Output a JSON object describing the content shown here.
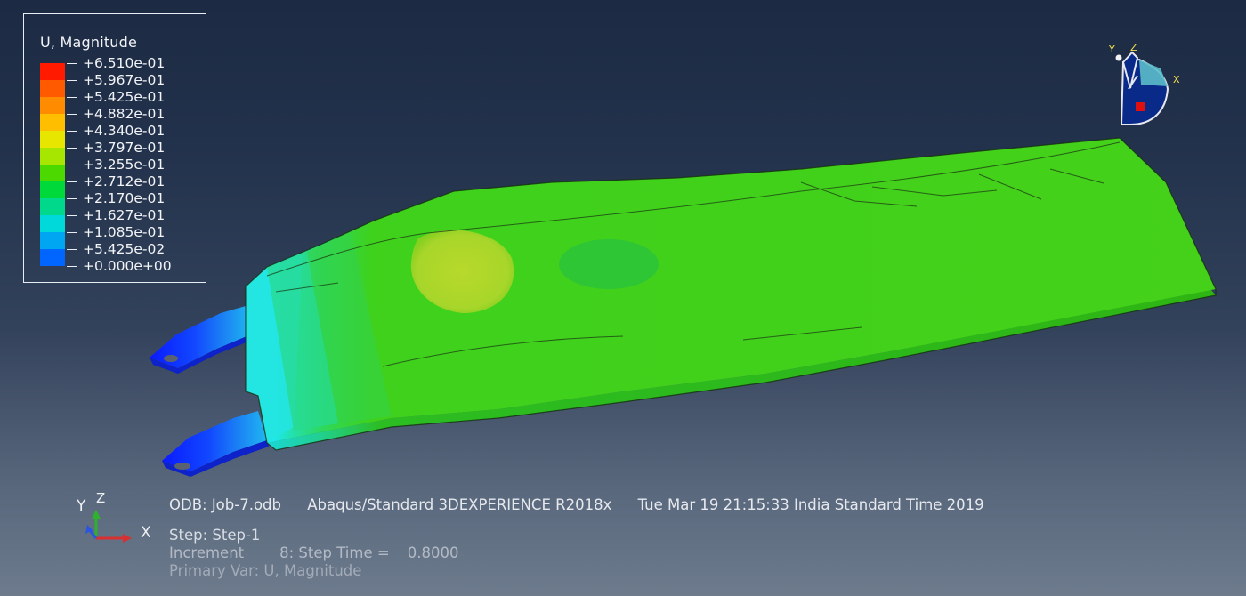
{
  "legend": {
    "title": "U, Magnitude",
    "entries": [
      {
        "label": "+6.510e-01",
        "color": "#ff1a00"
      },
      {
        "label": "+5.967e-01",
        "color": "#ff5a00"
      },
      {
        "label": "+5.425e-01",
        "color": "#ff8c00"
      },
      {
        "label": "+4.882e-01",
        "color": "#ffbf00"
      },
      {
        "label": "+4.340e-01",
        "color": "#e6e600"
      },
      {
        "label": "+3.797e-01",
        "color": "#a6e600"
      },
      {
        "label": "+3.255e-01",
        "color": "#4cd900"
      },
      {
        "label": "+2.712e-01",
        "color": "#00d93a"
      },
      {
        "label": "+2.170e-01",
        "color": "#00d98c"
      },
      {
        "label": "+1.627e-01",
        "color": "#00d9d9"
      },
      {
        "label": "+1.085e-01",
        "color": "#00a6f2"
      },
      {
        "label": "+5.425e-02",
        "color": "#0066ff"
      },
      {
        "label": "+0.000e+00",
        "color": "#0a1aff"
      }
    ]
  },
  "info": {
    "odb": "ODB: Job-7.odb",
    "solver": "Abaqus/Standard 3DEXPERIENCE R2018x",
    "timestamp": "Tue Mar 19 21:15:33 India Standard Time 2019",
    "step": "Step: Step-1",
    "increment_label": "Increment",
    "increment_value": "8: Step Time =",
    "step_time": "0.8000",
    "primary_var": "Primary Var: U, Magnitude"
  },
  "triad_main": {
    "y": "Y",
    "z": "Z",
    "x": "X"
  },
  "triad_view": {
    "y": "Y",
    "z": "Z",
    "x": "X"
  },
  "colors": {
    "part_green": "#3fd11c",
    "part_green_dark": "#2fb311",
    "hot_spot": "#b4d82a",
    "cool_spot": "#2ec43a",
    "blue_tabs": "#1a3cff",
    "cyan": "#1fe0e6"
  }
}
